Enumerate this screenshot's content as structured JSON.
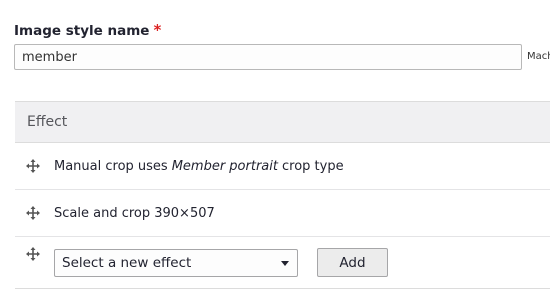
{
  "form": {
    "name_label": "Image style name",
    "required_mark": "*",
    "name_value": "member",
    "machine_name_prefix": "Mach"
  },
  "effects_table": {
    "header": "Effect",
    "rows": [
      {
        "prefix": "Manual crop uses",
        "emphasis": "Member portrait",
        "suffix": "crop type"
      },
      {
        "text": "Scale and crop 390×507"
      }
    ],
    "new_effect": {
      "select_value": "Select a new effect",
      "add_label": "Add"
    }
  },
  "icons": {
    "drag_handle": "move-arrows-icon",
    "select_caret": "chevron-down-icon"
  }
}
